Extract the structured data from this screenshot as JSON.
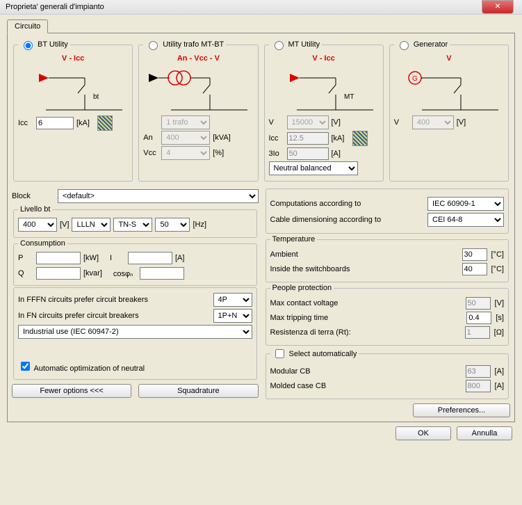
{
  "window": {
    "title": "Proprieta' generali d'impianto"
  },
  "tabs": {
    "circuito": "Circuito"
  },
  "sources": {
    "bt": {
      "legend": "BT Utility",
      "dia": "V - Icc",
      "tag": "bt",
      "icc_lbl": "Icc",
      "icc": "6",
      "icc_unit": "[kA]"
    },
    "trafo": {
      "legend": "Utility trafo MT-BT",
      "dia": "An - Vcc - V",
      "ntrafo": "1 trafo",
      "an_lbl": "An",
      "an": "400",
      "an_unit": "[kVA]",
      "vcc_lbl": "Vcc",
      "vcc": "4",
      "vcc_unit": "[%]"
    },
    "mt": {
      "legend": "MT Utility",
      "dia": "V - Icc",
      "tag": "MT",
      "v_lbl": "V",
      "v": "15000",
      "v_unit": "[V]",
      "icc_lbl": "Icc",
      "icc": "12.5",
      "icc_unit": "[kA]",
      "slo_lbl": "3Io",
      "slo": "50",
      "slo_unit": "[A]",
      "neutral": "Neutral balanced"
    },
    "gen": {
      "legend": "Generator",
      "dia": "V",
      "v_lbl": "V",
      "v": "400",
      "v_unit": "[V]"
    }
  },
  "block": {
    "label": "Block",
    "value": "<default>"
  },
  "livello": {
    "legend": "Livello bt",
    "v": "400",
    "v_unit": "[V]",
    "dist": "LLLN",
    "earth": "TN-S",
    "freq": "50",
    "freq_unit": "[Hz]"
  },
  "consumption": {
    "legend": "Consumption",
    "p_lbl": "P",
    "p": "",
    "p_unit": "[kW]",
    "i_lbl": "I",
    "i": "",
    "i_unit": "[A]",
    "q_lbl": "Q",
    "q": "",
    "q_unit": "[kvar]",
    "cos_lbl": "cosφₙ",
    "cos": ""
  },
  "cbprefs": {
    "fffn_lbl": "In FFFN circuits prefer circuit breakers",
    "fffn": "4P",
    "fn_lbl": "In FN circuits prefer circuit breakers",
    "fn": "1P+N",
    "use": "Industrial use (IEC 60947-2)",
    "auton": "Automatic optimization of neutral"
  },
  "standards": {
    "comp_lbl": "Computations according to",
    "comp": "IEC 60909-1",
    "cable_lbl": "Cable dimensioning according to",
    "cable": "CEI 64-8"
  },
  "temperature": {
    "legend": "Temperature",
    "amb_lbl": "Ambient",
    "amb": "30",
    "amb_unit": "[°C]",
    "ins_lbl": "Inside the switchboards",
    "ins": "40",
    "ins_unit": "[°C]"
  },
  "protection": {
    "legend": "People protection",
    "mcv_lbl": "Max contact voltage",
    "mcv": "50",
    "mcv_unit": "[V]",
    "mtt_lbl": "Max tripping time",
    "mtt": "0.4",
    "mtt_unit": "[s]",
    "rt_lbl": "Resistenza di terra (Rt):",
    "rt": "1",
    "rt_unit": "[Ω]"
  },
  "autosel": {
    "legend": "Select automatically",
    "mod_lbl": "Modular CB",
    "mod": "63",
    "mod_unit": "[A]",
    "mcc_lbl": "Molded case CB",
    "mcc": "800",
    "mcc_unit": "[A]"
  },
  "buttons": {
    "fewer": "Fewer options <<<",
    "squad": "Squadrature",
    "prefs": "Preferences...",
    "ok": "OK",
    "cancel": "Annulla"
  }
}
